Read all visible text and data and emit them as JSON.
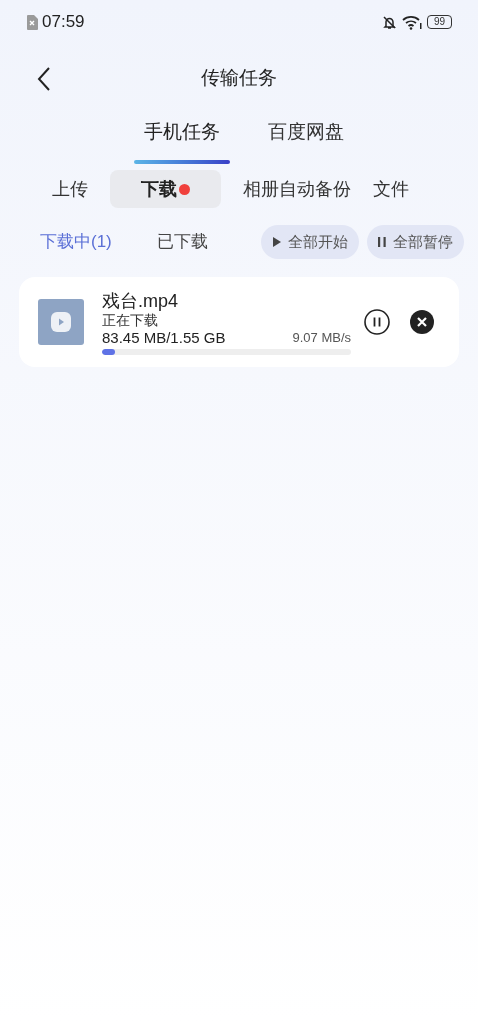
{
  "status_bar": {
    "time": "07:59",
    "battery": "99"
  },
  "header": {
    "title": "传输任务"
  },
  "top_tabs": [
    {
      "label": "手机任务",
      "selected": true
    },
    {
      "label": "百度网盘",
      "selected": false
    }
  ],
  "sub_tabs": [
    {
      "label": "上传",
      "selected": false,
      "badge": false
    },
    {
      "label": "下载",
      "selected": true,
      "badge": true
    },
    {
      "label": "相册自动备份",
      "selected": false,
      "badge": false
    },
    {
      "label": "文件",
      "selected": false,
      "badge": false
    }
  ],
  "filters": [
    {
      "label": "下载中(1)",
      "selected": true
    },
    {
      "label": "已下载",
      "selected": false
    }
  ],
  "actions": [
    {
      "kind": "start",
      "label": "全部开始"
    },
    {
      "kind": "pause",
      "label": "全部暂停"
    }
  ],
  "downloads": [
    {
      "name": "戏台.mp4",
      "status": "正在下载",
      "size": "83.45 MB/1.55 GB",
      "speed": "9.07 MB/s",
      "level": 0.054
    }
  ]
}
